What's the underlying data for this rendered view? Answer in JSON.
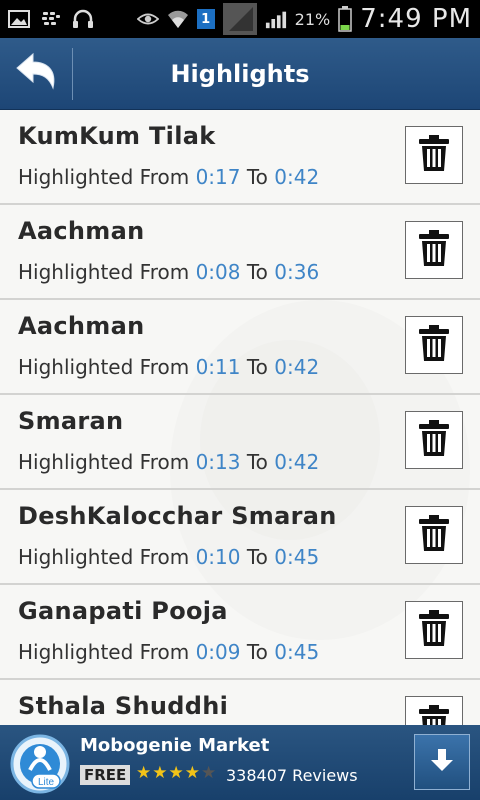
{
  "status_bar": {
    "sim_label": "1",
    "battery_percent": "21%",
    "time": "7:49 PM",
    "icons": [
      "image-icon",
      "bbm-icon",
      "headphones-icon",
      "eye-icon",
      "wifi-icon",
      "sim-icon",
      "signal-icon",
      "signal-bars-icon",
      "battery-icon"
    ]
  },
  "action_bar": {
    "title": "Highlights",
    "back_icon": "back-arrow-icon",
    "color": "#1d4676"
  },
  "highlights": [
    {
      "title": "KumKum Tilak",
      "prefix": "Highlighted From ",
      "from": "0:17",
      "to_word": " To ",
      "to": "0:42"
    },
    {
      "title": "Aachman",
      "prefix": "Highlighted From ",
      "from": "0:08",
      "to_word": " To ",
      "to": "0:36"
    },
    {
      "title": "Aachman",
      "prefix": "Highlighted From ",
      "from": "0:11",
      "to_word": " To ",
      "to": "0:42"
    },
    {
      "title": "Smaran",
      "prefix": "Highlighted From ",
      "from": "0:13",
      "to_word": " To ",
      "to": "0:42"
    },
    {
      "title": "DeshKalocchar Smaran",
      "prefix": "Highlighted From ",
      "from": "0:10",
      "to_word": " To ",
      "to": "0:45"
    },
    {
      "title": "Ganapati Pooja",
      "prefix": "Highlighted From ",
      "from": "0:09",
      "to_word": " To ",
      "to": "0:45"
    },
    {
      "title": "Sthala Shuddhi",
      "prefix": "",
      "from": "",
      "to_word": "",
      "to": ""
    }
  ],
  "ad": {
    "app_name": "Mobogenie Market",
    "price": "FREE",
    "rating": 4,
    "rating_max": 5,
    "reviews": "338407 Reviews",
    "logo_text": "Lite",
    "download_icon": "download-arrow-icon"
  },
  "colors": {
    "accent_time": "#3f85c7",
    "header": "#1d4676"
  }
}
